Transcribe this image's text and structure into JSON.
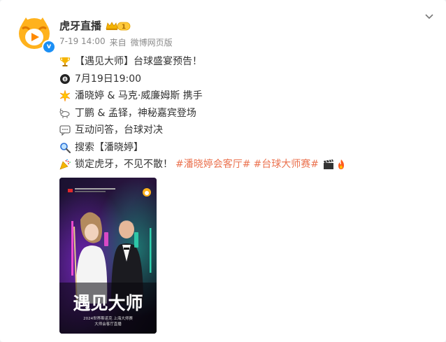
{
  "post": {
    "author": "虎牙直播",
    "time": "7-19 14:00",
    "source_prefix": "来自",
    "source": "微博网页版",
    "lines": [
      {
        "icon": "trophy-icon",
        "text": "【遇见大师】台球盛宴预告！"
      },
      {
        "icon": "eight-ball-icon",
        "text": "7月19日19:00"
      },
      {
        "icon": "sparkle-icon",
        "text": "潘晓婷 & 马克·威廉姆斯 携手"
      },
      {
        "icon": "goat-icon",
        "text": "丁鹏 & 孟铎，神秘嘉宾登场"
      },
      {
        "icon": "speech-bubble-icon",
        "text": "互动问答，台球对决"
      },
      {
        "icon": "magnifier-icon",
        "text": "搜索【潘晓婷】"
      }
    ],
    "last_line": {
      "icon": "party-popper-icon",
      "text": "锁定虎牙，不见不散！",
      "tag1": "#潘晓婷会客厅#",
      "tag2": "#台球大师赛#"
    }
  },
  "poster": {
    "title": "遇见大师",
    "subtitle_line1": "2024世界斯诺克 上海大师赛",
    "subtitle_line2": "大师会客厅直播"
  },
  "colors": {
    "accent_orange": "#eb7350",
    "verified_blue": "#1b8ff5",
    "meta_gray": "#8a8a8a"
  }
}
